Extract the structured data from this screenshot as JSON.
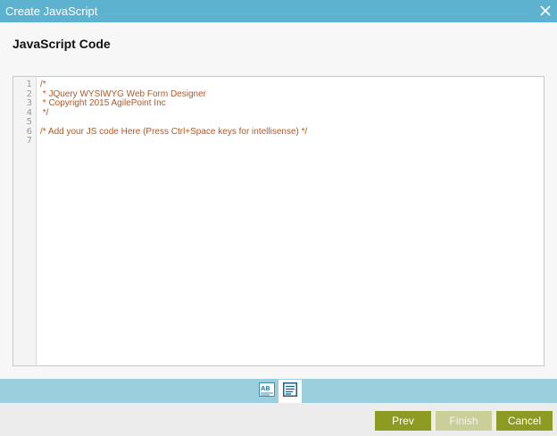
{
  "dialog": {
    "title": "Create JavaScript",
    "close_icon": "close-icon"
  },
  "page": {
    "heading": "JavaScript Code"
  },
  "editor": {
    "line_numbers": [
      "1",
      "2",
      "3",
      "4",
      "5",
      "6",
      "7"
    ],
    "lines": [
      "/*",
      " * JQuery WYSIWYG Web Form Designer",
      " * Copyright 2015 AgilePoint Inc",
      " */",
      "",
      "/* Add your JS code Here (Press Ctrl+Space keys for intellisense) */",
      ""
    ],
    "code_color": "#b7561d"
  },
  "view_tabs": {
    "design_icon": "design-view-icon",
    "code_icon": "code-view-icon",
    "active": "code"
  },
  "buttons": {
    "prev": "Prev",
    "finish": "Finish",
    "cancel": "Cancel",
    "finish_disabled": true
  },
  "colors": {
    "titlebar": "#5db3cf",
    "tabstrip": "#9ccfde",
    "button_primary": "#8d9b22",
    "button_disabled": "#c9cf97"
  }
}
